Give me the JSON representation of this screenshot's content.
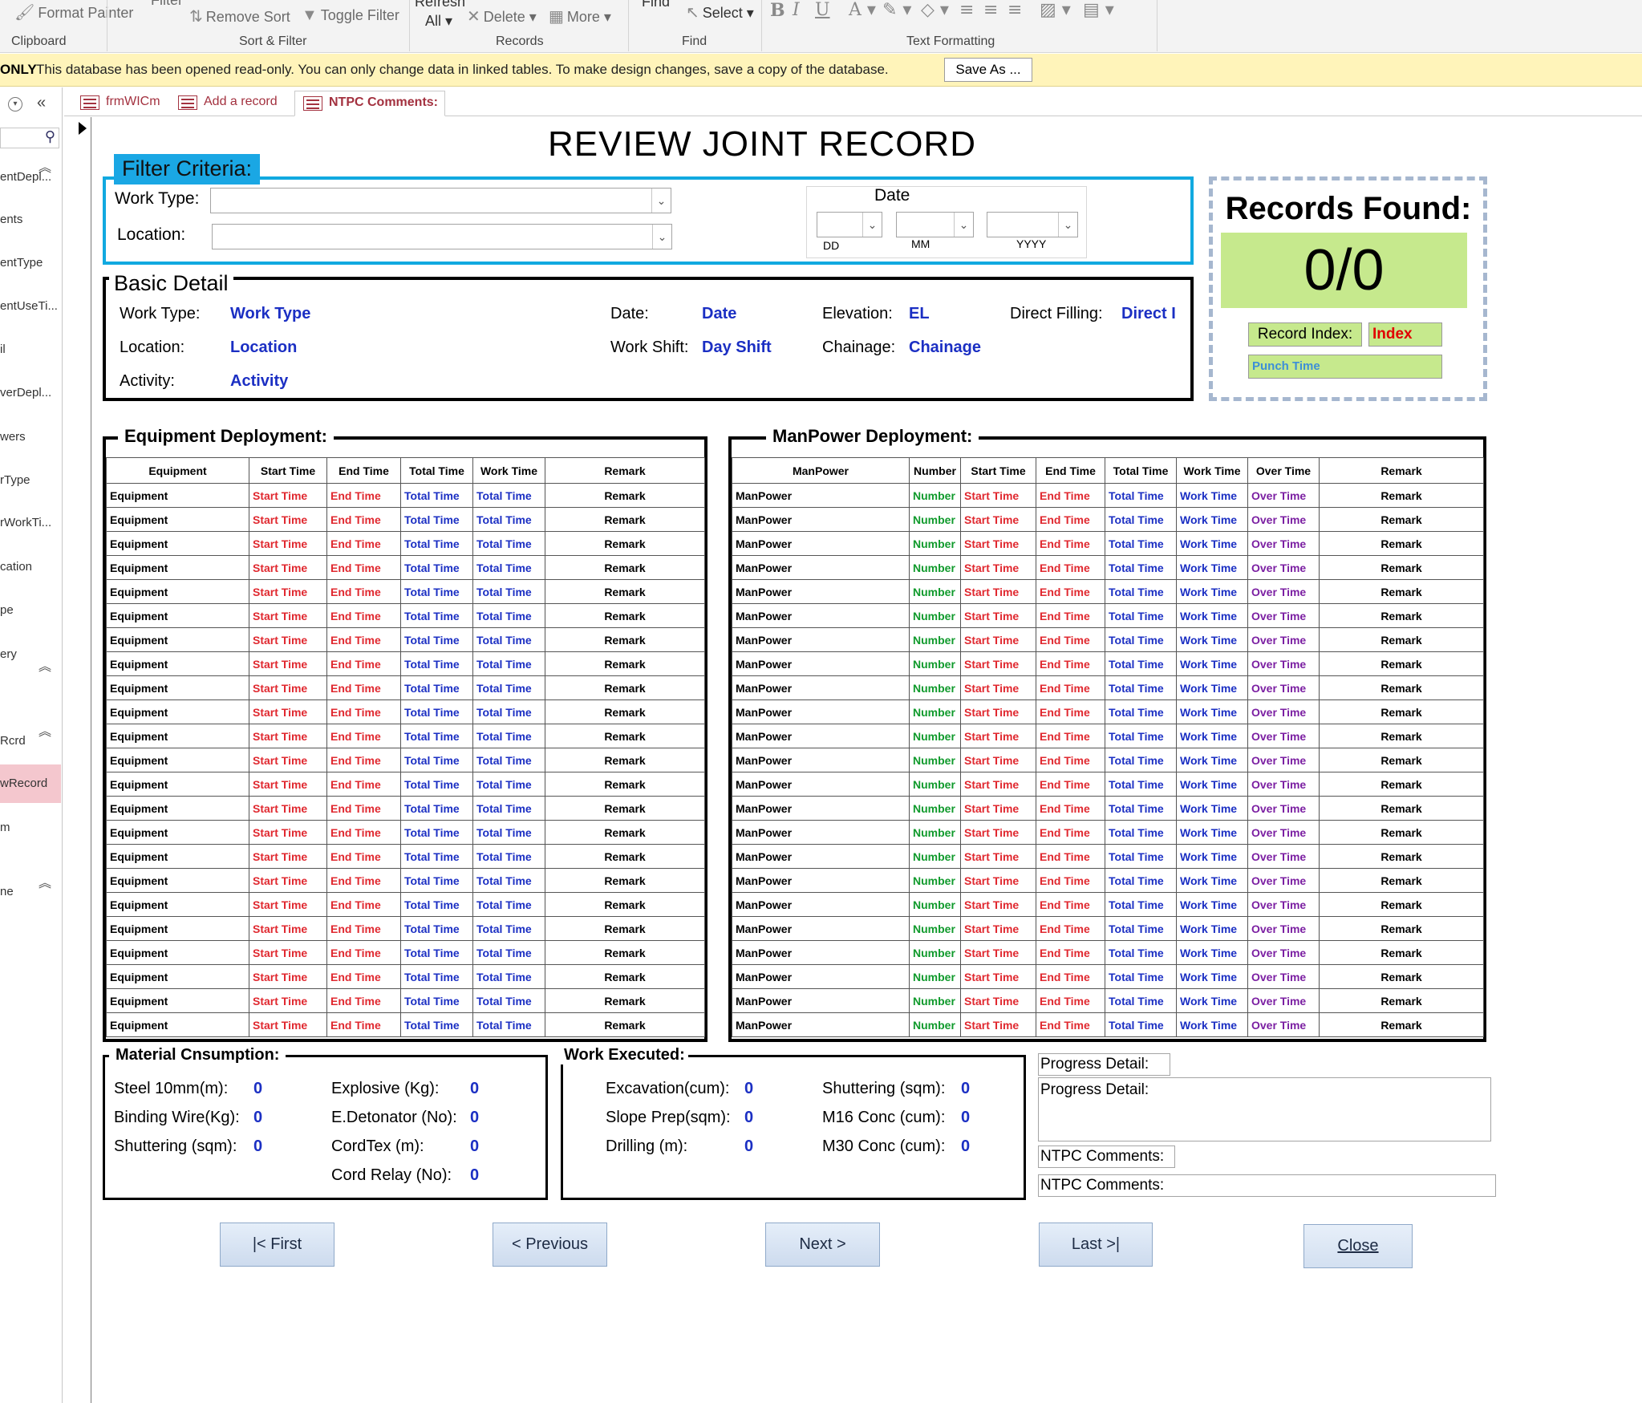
{
  "ribbon": {
    "format_painter": "Format Painter",
    "filter": "Filter",
    "remove_sort": "Remove Sort",
    "toggle_filter": "Toggle Filter",
    "refresh": "Refresh",
    "refresh_all": "All",
    "delete": "Delete",
    "more": "More",
    "find": "Find",
    "select": "Select",
    "groups": {
      "clipboard": "Clipboard",
      "sort_filter": "Sort & Filter",
      "records": "Records",
      "find": "Find",
      "text_formatting": "Text Formatting"
    }
  },
  "message_bar": {
    "label": "ONLY",
    "text": "This database has been opened read-only. You can only change data in linked tables. To make design changes, save a copy of the database.",
    "save_as": "Save As ..."
  },
  "nav_pane": {
    "items": [
      "entDepl...",
      "ents",
      "entType",
      "entUseTi...",
      "il",
      "verDepl...",
      "wers",
      "rType",
      "rWorkTi...",
      "cation",
      "pe",
      "ery",
      "Rcrd",
      "wRecord",
      "m",
      "ne"
    ],
    "selected": "wRecord"
  },
  "tabs": [
    {
      "label": "frmWICm"
    },
    {
      "label": "Add a record"
    },
    {
      "label": "NTPC Comments:"
    }
  ],
  "form": {
    "title": "REVIEW JOINT RECORD",
    "filter": {
      "legend": "Filter Criteria:",
      "work_type_label": "Work Type:",
      "location_label": "Location:",
      "date_label": "Date",
      "dd": "DD",
      "mm": "MM",
      "yyyy": "YYYY"
    },
    "records_found": {
      "title": "Records Found:",
      "count": "0/0",
      "index_label": "Record Index:",
      "index_value": "Index",
      "punch_time": "Punch Time"
    },
    "basic": {
      "legend": "Basic Detail",
      "work_type_label": "Work Type:",
      "work_type_value": "Work Type",
      "location_label": "Location:",
      "location_value": "Location",
      "activity_label": "Activity:",
      "activity_value": "Activity",
      "date_label": "Date:",
      "date_value": "Date",
      "shift_label": "Work Shift:",
      "shift_value": "Day Shift",
      "elevation_label": "Elevation:",
      "elevation_value": "EL",
      "chainage_label": "Chainage:",
      "chainage_value": "Chainage",
      "direct_label": "Direct Filling:",
      "direct_value": "Direct I"
    },
    "equipment": {
      "legend": "Equipment Deployment:",
      "headers": [
        "Equipment",
        "Start Time",
        "End Time",
        "Total Time",
        "Work Time",
        "Remark"
      ],
      "row": [
        "Equipment",
        "Start Time",
        "End Time",
        "Total Time",
        "Total Time",
        "Remark"
      ],
      "row_count": 23
    },
    "manpower": {
      "legend": "ManPower Deployment:",
      "headers": [
        "ManPower",
        "Number",
        "Start Time",
        "End Time",
        "Total Time",
        "Work Time",
        "Over Time",
        "Remark"
      ],
      "row": [
        "ManPower",
        "Number",
        "Start Time",
        "End Time",
        "Total Time",
        "Work Time",
        "Over Time",
        "Remark"
      ],
      "row_count": 23
    },
    "material": {
      "legend": "Material Cnsumption:",
      "items": [
        {
          "label": "Steel 10mm(m):",
          "value": "0"
        },
        {
          "label": "Binding Wire(Kg):",
          "value": "0"
        },
        {
          "label": "Shuttering (sqm):",
          "value": "0"
        },
        {
          "label": "Explosive (Kg):",
          "value": "0"
        },
        {
          "label": "E.Detonator (No):",
          "value": "0"
        },
        {
          "label": "CordTex (m):",
          "value": "0"
        },
        {
          "label": "Cord Relay (No):",
          "value": "0"
        }
      ]
    },
    "work": {
      "legend": "Work Executed:",
      "items": [
        {
          "label": "Excavation(cum):",
          "value": "0"
        },
        {
          "label": "Slope Prep(sqm):",
          "value": "0"
        },
        {
          "label": "Drilling (m):",
          "value": "0"
        },
        {
          "label": "Shuttering (sqm):",
          "value": "0"
        },
        {
          "label": "M16 Conc (cum):",
          "value": "0"
        },
        {
          "label": "M30 Conc (cum):",
          "value": "0"
        }
      ]
    },
    "progress": {
      "label": "Progress Detail:",
      "value": "Progress Detail:"
    },
    "comments": {
      "label": "NTPC Comments:",
      "value": "NTPC Comments:"
    },
    "buttons": {
      "first": "|<  First",
      "previous": "<  Previous",
      "next": "Next  >",
      "last": "Last  >|",
      "close": "Close"
    }
  },
  "colors": {
    "filter_border": "#11a9e0",
    "records_green": "#c6e98d",
    "value_blue": "#1b2fc3",
    "time_red": "#e0282f",
    "number_green": "#109a2c",
    "overtime_purple": "#7b1fa2",
    "selected_nav": "#f4c7ce",
    "message_bar": "#fff4ba"
  }
}
